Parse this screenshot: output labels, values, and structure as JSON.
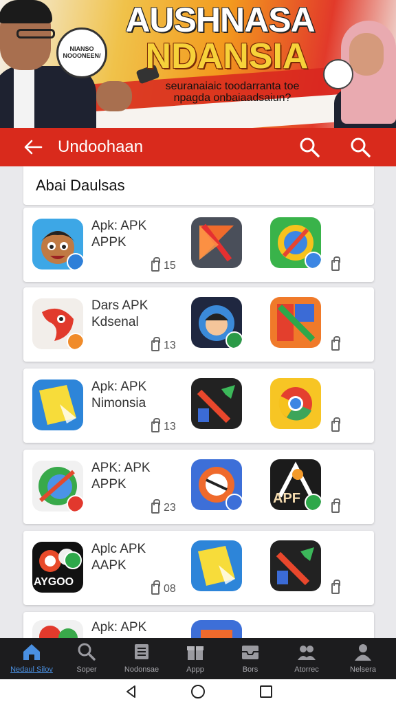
{
  "banner": {
    "badge_text": "NIANSO NOOONEEN/",
    "title_line1": "AUSHNASA",
    "title_line2": "NDANSIA",
    "subtitle": "seuranaiaic toodarranta toe npagda onbaiaadsaiun?"
  },
  "appbar": {
    "title": "Undoohaan",
    "back_icon": "back-arrow-icon",
    "search_icon": "search-icon"
  },
  "section": {
    "title": "Abai Daulsas"
  },
  "rows": [
    {
      "name_line1": "Apk: APK",
      "name_line2": "APPK",
      "count": "15"
    },
    {
      "name_line1": "Dars APK",
      "name_line2": "Kdsenal",
      "count": "13"
    },
    {
      "name_line1": "Apk: APK",
      "name_line2": "Nimonsia",
      "count": "13"
    },
    {
      "name_line1": "APK: APK",
      "name_line2": "APPK",
      "count": "23"
    },
    {
      "name_line1": "Aplc APK",
      "name_line2": "AAPK",
      "count": "08",
      "tile_label": "AYGOO"
    },
    {
      "name_line1": "Apk: APK",
      "name_line2": "",
      "count": ""
    }
  ],
  "row4": {
    "tile_text": "APF"
  },
  "bottom_nav": {
    "items": [
      {
        "label": "Nedaul Silov",
        "icon": "home-icon",
        "active": true
      },
      {
        "label": "Soper",
        "icon": "search-icon"
      },
      {
        "label": "Nodonsae",
        "icon": "list-icon"
      },
      {
        "label": "Appp",
        "icon": "gift-icon"
      },
      {
        "label": "Bors",
        "icon": "inbox-icon"
      },
      {
        "label": "Atorrec",
        "icon": "group-icon"
      },
      {
        "label": "Nelsera",
        "icon": "profile-icon"
      }
    ]
  },
  "colors": {
    "accent_red": "#d92a1c",
    "nav_bg": "#1c1c1e",
    "active_blue": "#4a90e2"
  }
}
